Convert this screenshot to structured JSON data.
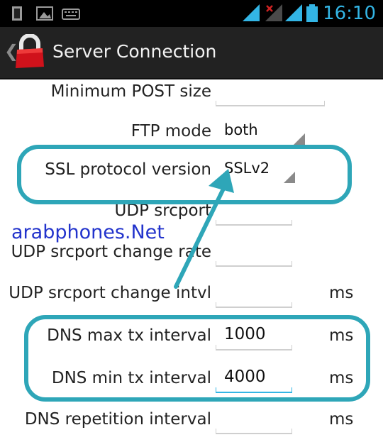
{
  "status_bar": {
    "time": "16:10",
    "icons": [
      "sd-card-icon",
      "image-icon",
      "keyboard-icon",
      "wifi-icon",
      "signal-no-service-icon",
      "signal-icon",
      "battery-icon"
    ],
    "accent_color": "#33b5e5"
  },
  "action_bar": {
    "title": "Server Connection",
    "icon": "lock-icon"
  },
  "settings": {
    "min_post_size": {
      "label": "Minimum POST size",
      "value": ""
    },
    "ftp_mode": {
      "label": "FTP mode",
      "value": "both"
    },
    "ssl_protocol": {
      "label": "SSL protocol version",
      "value": "SSLv2"
    },
    "udp_srcport": {
      "label": "UDP srcport",
      "value": ""
    },
    "udp_srcport_change_rate": {
      "label": "UDP srcport change rate",
      "value": ""
    },
    "udp_srcport_change_intvl": {
      "label": "UDP srcport change intvl",
      "value": "",
      "unit": "ms"
    },
    "dns_max_tx": {
      "label": "DNS max tx interval",
      "value": "1000",
      "unit": "ms"
    },
    "dns_min_tx": {
      "label": "DNS min tx interval",
      "value": "4000",
      "unit": "ms"
    },
    "dns_repetition": {
      "label": "DNS repetition interval",
      "value": "",
      "unit": "ms"
    }
  },
  "watermark": "arabphones.Net",
  "highlight_color": "#2ea6b8"
}
